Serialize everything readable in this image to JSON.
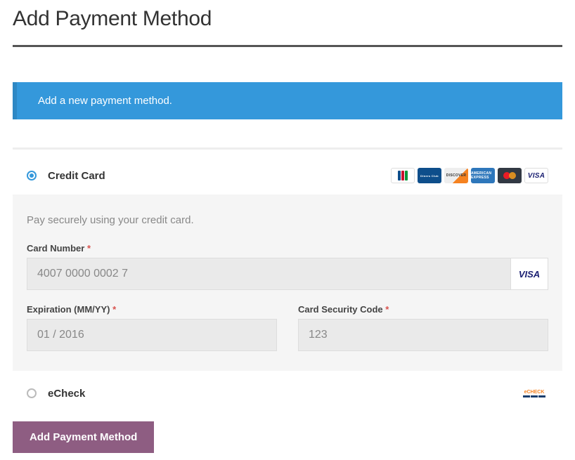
{
  "page_title": "Add Payment Method",
  "info_banner": "Add a new payment method.",
  "payment_options": {
    "credit_card": {
      "label": "Credit Card",
      "selected": true
    },
    "echeck": {
      "label": "eCheck",
      "selected": false
    }
  },
  "form": {
    "instruction": "Pay securely using your credit card.",
    "card_number_label": "Card Number",
    "card_number_value": "4007 0000 0002 7",
    "detected_card_type": "VISA",
    "expiration_label": "Expiration (MM/YY)",
    "expiration_value": "01 / 2016",
    "cvv_label": "Card Security Code",
    "cvv_value": "123",
    "required_mark": "*"
  },
  "submit_button_label": "Add Payment Method",
  "card_brands": {
    "visa": "VISA",
    "diners": "Diners Club",
    "discover": "DISCOVER",
    "amex": "AMERICAN EXPRESS"
  },
  "echeck_brand": "eCHECK"
}
